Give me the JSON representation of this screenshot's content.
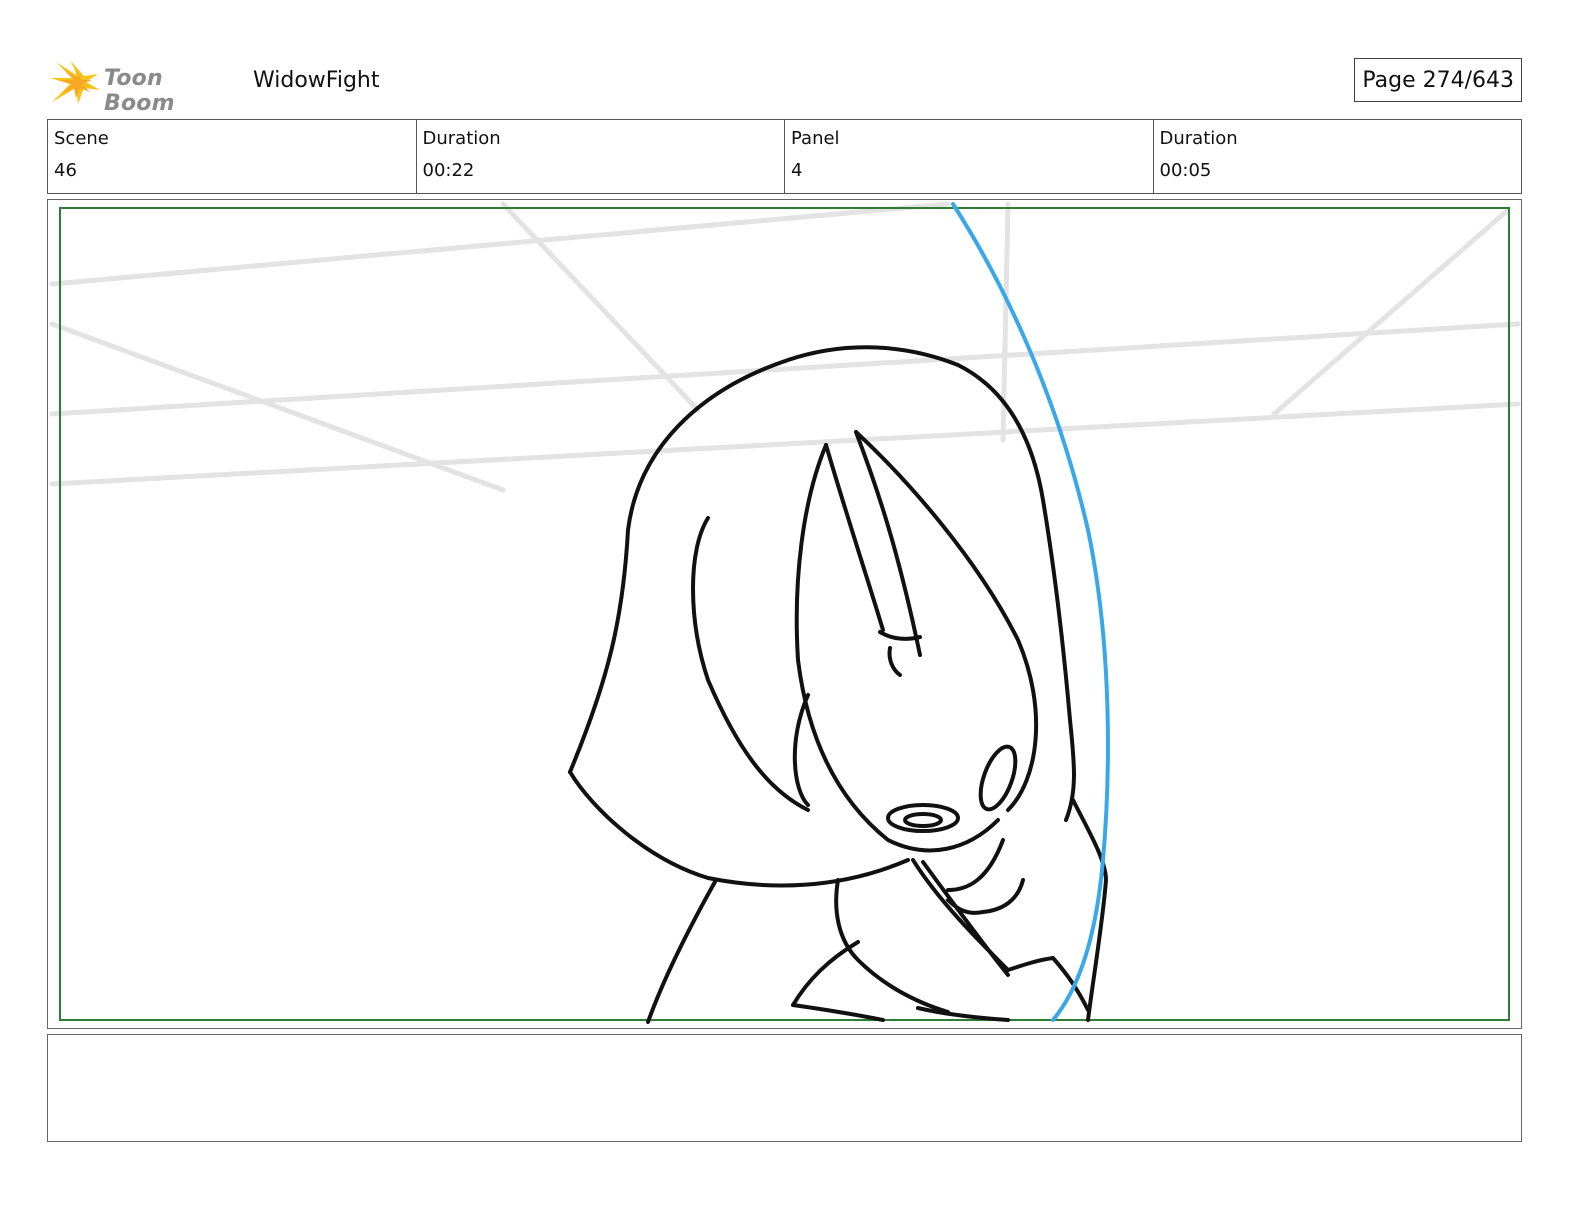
{
  "header": {
    "logo_text": "Toon Boom",
    "project_title": "WidowFight",
    "page_indicator": "Page 274/643"
  },
  "info": {
    "scene_label": "Scene",
    "scene_value": "46",
    "scene_duration_label": "Duration",
    "scene_duration_value": "00:22",
    "panel_label": "Panel",
    "panel_value": "4",
    "panel_duration_label": "Duration",
    "panel_duration_value": "00:05"
  },
  "panel": {
    "sketch_subject": "character-head-bowed",
    "camera_frame_color": "#2e7d32",
    "motion_line_color": "#3aa8e8",
    "background_line_color": "#e3e3e3",
    "ink_color": "#111111"
  },
  "notes": {
    "text": ""
  }
}
